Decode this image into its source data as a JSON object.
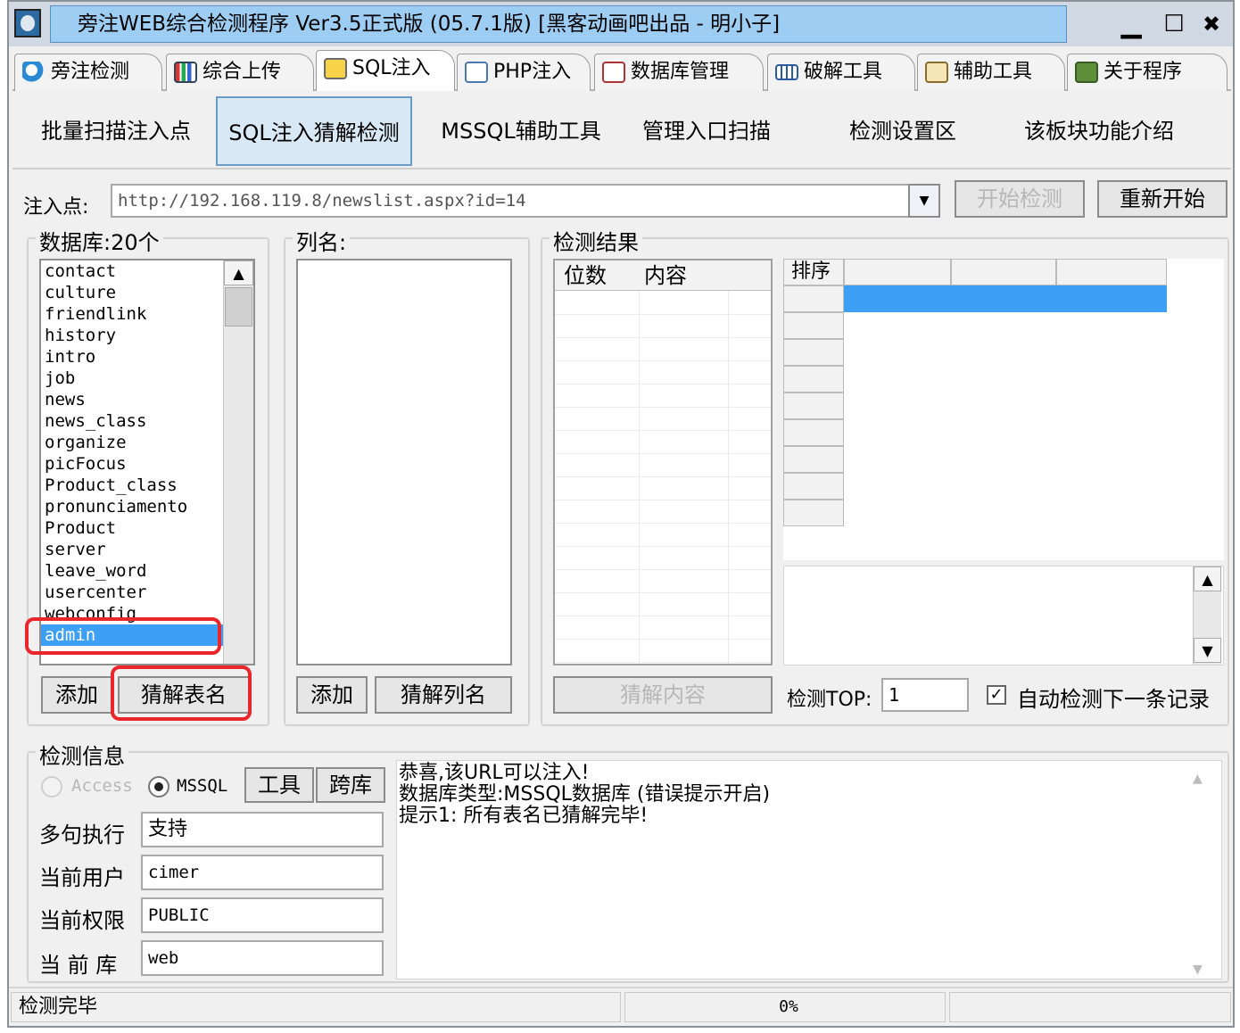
{
  "window": {
    "title": "旁注WEB综合检测程序 Ver3.5正式版 (05.7.1版) [黑客动画吧出品 - 明小子]",
    "minimize": "▁",
    "maximize": "☐",
    "close": "✖"
  },
  "tabs": [
    {
      "label": "旁注检测",
      "icon": "magnifier-icon"
    },
    {
      "label": "综合上传",
      "icon": "chart-icon"
    },
    {
      "label": "SQL注入",
      "icon": "search-doc-icon"
    },
    {
      "label": "PHP注入",
      "icon": "php-icon"
    },
    {
      "label": "数据库管理",
      "icon": "database-icon"
    },
    {
      "label": "破解工具",
      "icon": "keyboard-icon"
    },
    {
      "label": "辅助工具",
      "icon": "clipboard-icon"
    },
    {
      "label": "关于程序",
      "icon": "book-icon"
    }
  ],
  "subtabs": [
    "批量扫描注入点",
    "SQL注入猜解检测",
    "MSSQL辅助工具",
    "管理入口扫描",
    "检测设置区",
    "该板块功能介绍"
  ],
  "inject": {
    "label": "注入点:",
    "url": "http://192.168.119.8/newslist.aspx?id=14",
    "start_button": "开始检测",
    "restart_button": "重新开始"
  },
  "database": {
    "label": "数据库:20个",
    "tables": [
      "contact",
      "culture",
      "friendlink",
      "history",
      "intro",
      "job",
      "news",
      "news_class",
      "organize",
      "picFocus",
      "Product_class",
      "pronunciamento",
      "Product",
      "server",
      "leave_word",
      "usercenter",
      "webconfig",
      "admin"
    ],
    "selected": "admin",
    "add_button": "添加",
    "guess_button": "猜解表名"
  },
  "columns": {
    "label": "列名:",
    "add_button": "添加",
    "guess_button": "猜解列名"
  },
  "result": {
    "label": "检测结果",
    "col_digits": "位数",
    "col_content": "内容",
    "sort_header": "排序",
    "guess_content_button": "猜解内容",
    "top_label": "检测TOP:",
    "top_value": "1",
    "auto_next_label": "自动检测下一条记录",
    "auto_next_checked": true
  },
  "info": {
    "label": "检测信息",
    "access_label": "Access",
    "mssql_label": "MSSQL",
    "tools_button": "工具",
    "crossdb_button": "跨库",
    "multi_label": "多句执行",
    "multi_value": "支持",
    "user_label": "当前用户",
    "user_value": "cimer",
    "perm_label": "当前权限",
    "perm_value": "PUBLIC",
    "db_label": "当 前 库",
    "db_value": "web",
    "log": [
      "恭喜,该URL可以注入!",
      "数据库类型:MSSQL数据库 (错误提示开启)",
      "提示1: 所有表名已猜解完毕!"
    ]
  },
  "status": {
    "text": "检测完毕",
    "progress": "0%"
  }
}
